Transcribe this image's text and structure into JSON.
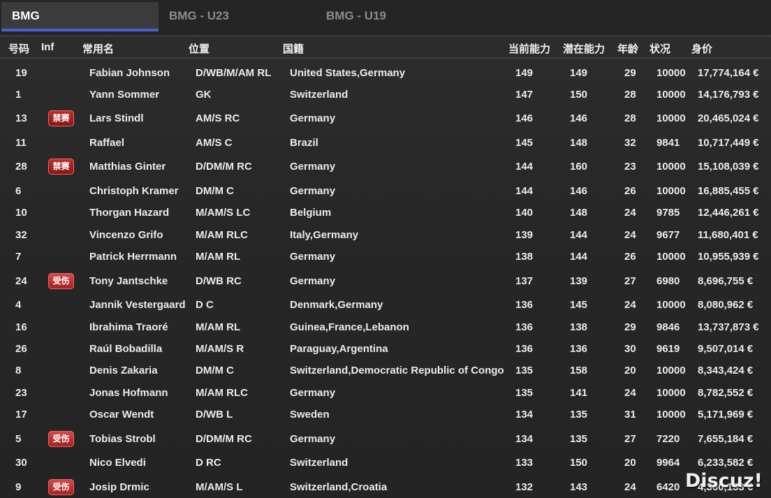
{
  "tabs": [
    {
      "label": "BMG",
      "active": true
    },
    {
      "label": "BMG - U23",
      "active": false
    },
    {
      "label": "BMG - U19",
      "active": false
    }
  ],
  "columns": {
    "number": "号码",
    "inf": "Inf",
    "name": "常用名",
    "position": "位置",
    "nationality": "国籍",
    "ca": "当前能力",
    "pa": "潜在能力",
    "age": "年龄",
    "condition": "状况",
    "value": "身价"
  },
  "players": [
    {
      "number": "19",
      "inf": "",
      "inf_type": "",
      "name": "Fabian Johnson",
      "position": "D/WB/M/AM RL",
      "nationality": "United States,Germany",
      "ca": "149",
      "pa": "149",
      "age": "29",
      "condition": "10000",
      "value": "17,774,164 €"
    },
    {
      "number": "1",
      "inf": "",
      "inf_type": "",
      "name": "Yann Sommer",
      "position": "GK",
      "nationality": "Switzerland",
      "ca": "147",
      "pa": "150",
      "age": "28",
      "condition": "10000",
      "value": "14,176,793 €"
    },
    {
      "number": "13",
      "inf": "禁赛",
      "inf_type": "ban",
      "name": "Lars Stindl",
      "position": "AM/S RC",
      "nationality": "Germany",
      "ca": "146",
      "pa": "146",
      "age": "28",
      "condition": "10000",
      "value": "20,465,024 €"
    },
    {
      "number": "11",
      "inf": "",
      "inf_type": "",
      "name": "Raffael",
      "position": "AM/S C",
      "nationality": "Brazil",
      "ca": "145",
      "pa": "148",
      "age": "32",
      "condition": "9841",
      "value": "10,717,449 €"
    },
    {
      "number": "28",
      "inf": "禁赛",
      "inf_type": "ban",
      "name": "Matthias Ginter",
      "position": "D/DM/M RC",
      "nationality": "Germany",
      "ca": "144",
      "pa": "160",
      "age": "23",
      "condition": "10000",
      "value": "15,108,039 €"
    },
    {
      "number": "6",
      "inf": "",
      "inf_type": "",
      "name": "Christoph Kramer",
      "position": "DM/M C",
      "nationality": "Germany",
      "ca": "144",
      "pa": "146",
      "age": "26",
      "condition": "10000",
      "value": "16,885,455 €"
    },
    {
      "number": "10",
      "inf": "",
      "inf_type": "",
      "name": "Thorgan Hazard",
      "position": "M/AM/S LC",
      "nationality": "Belgium",
      "ca": "140",
      "pa": "148",
      "age": "24",
      "condition": "9785",
      "value": "12,446,261 €"
    },
    {
      "number": "32",
      "inf": "",
      "inf_type": "",
      "name": "Vincenzo Grifo",
      "position": "M/AM RLC",
      "nationality": "Italy,Germany",
      "ca": "139",
      "pa": "144",
      "age": "24",
      "condition": "9677",
      "value": "11,680,401 €"
    },
    {
      "number": "7",
      "inf": "",
      "inf_type": "",
      "name": "Patrick Herrmann",
      "position": "M/AM RL",
      "nationality": "Germany",
      "ca": "138",
      "pa": "144",
      "age": "26",
      "condition": "10000",
      "value": "10,955,939 €"
    },
    {
      "number": "24",
      "inf": "受伤",
      "inf_type": "injury",
      "name": "Tony Jantschke",
      "position": "D/WB RC",
      "nationality": "Germany",
      "ca": "137",
      "pa": "139",
      "age": "27",
      "condition": "6980",
      "value": "8,696,755 €"
    },
    {
      "number": "4",
      "inf": "",
      "inf_type": "",
      "name": "Jannik Vestergaard",
      "position": "D C",
      "nationality": "Denmark,Germany",
      "ca": "136",
      "pa": "145",
      "age": "24",
      "condition": "10000",
      "value": "8,080,962 €"
    },
    {
      "number": "16",
      "inf": "",
      "inf_type": "",
      "name": "Ibrahima Traoré",
      "position": "M/AM RL",
      "nationality": "Guinea,France,Lebanon",
      "ca": "136",
      "pa": "138",
      "age": "29",
      "condition": "9846",
      "value": "13,737,873 €"
    },
    {
      "number": "26",
      "inf": "",
      "inf_type": "",
      "name": "Raúl Bobadilla",
      "position": "M/AM/S R",
      "nationality": "Paraguay,Argentina",
      "ca": "136",
      "pa": "136",
      "age": "30",
      "condition": "9619",
      "value": "9,507,014 €"
    },
    {
      "number": "8",
      "inf": "",
      "inf_type": "",
      "name": "Denis Zakaria",
      "position": "DM/M C",
      "nationality": "Switzerland,Democratic Republic of Congo",
      "ca": "135",
      "pa": "158",
      "age": "20",
      "condition": "10000",
      "value": "8,343,424 €"
    },
    {
      "number": "23",
      "inf": "",
      "inf_type": "",
      "name": "Jonas Hofmann",
      "position": "M/AM RLC",
      "nationality": "Germany",
      "ca": "135",
      "pa": "141",
      "age": "24",
      "condition": "10000",
      "value": "8,782,552 €"
    },
    {
      "number": "17",
      "inf": "",
      "inf_type": "",
      "name": "Oscar Wendt",
      "position": "D/WB L",
      "nationality": "Sweden",
      "ca": "134",
      "pa": "135",
      "age": "31",
      "condition": "10000",
      "value": "5,171,969 €"
    },
    {
      "number": "5",
      "inf": "受伤",
      "inf_type": "injury",
      "name": "Tobias Strobl",
      "position": "D/DM/M RC",
      "nationality": "Germany",
      "ca": "134",
      "pa": "135",
      "age": "27",
      "condition": "7220",
      "value": "7,655,184 €"
    },
    {
      "number": "30",
      "inf": "",
      "inf_type": "",
      "name": "Nico Elvedi",
      "position": "D RC",
      "nationality": "Switzerland",
      "ca": "133",
      "pa": "150",
      "age": "20",
      "condition": "9964",
      "value": "6,233,582 €"
    },
    {
      "number": "9",
      "inf": "受伤",
      "inf_type": "injury",
      "name": "Josip Drmic",
      "position": "M/AM/S L",
      "nationality": "Switzerland,Croatia",
      "ca": "132",
      "pa": "143",
      "age": "24",
      "condition": "6420",
      "value": "4,360,133 €"
    }
  ],
  "watermark": "Discuz!"
}
